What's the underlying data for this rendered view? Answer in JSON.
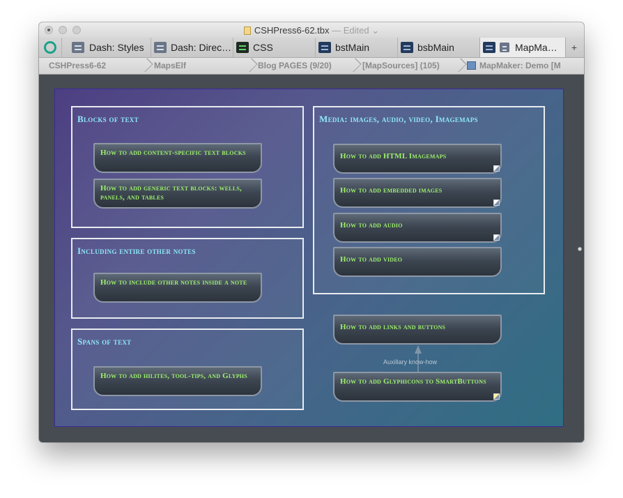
{
  "window": {
    "title": "CSHPress6-62.tbx",
    "edited": "— Edited"
  },
  "tabs": [
    {
      "label": "Dash: Styles"
    },
    {
      "label": "Dash: Direc…"
    },
    {
      "label": "CSS"
    },
    {
      "label": "bstMain"
    },
    {
      "label": "bsbMain"
    },
    {
      "label": "MapMa…"
    }
  ],
  "new_tab_label": "+",
  "breadcrumbs": [
    "CSHPress6-62",
    "MapsElf",
    "Blog PAGES (9/20)",
    "[MapSources] (105)",
    "MapMaker: Demo [M"
  ],
  "map": {
    "containers": [
      {
        "title": "Blocks of text",
        "notes": [
          "How to add content-specific text blocks",
          "How to add generic text blocks: wells, panels, and tables"
        ]
      },
      {
        "title": "Including entire other notes",
        "notes": [
          "How to include other notes inside a note"
        ]
      },
      {
        "title": "Spans of text",
        "notes": [
          "How to add hilites, tool-tips, and Glyphs"
        ]
      },
      {
        "title": "Media: images, audio, video, Imagemaps",
        "notes": [
          "How to add HTML Imagemaps",
          "How to add embedded images",
          "How to add audio",
          "How to add video"
        ]
      }
    ],
    "loose_notes": [
      "How to add links and buttons",
      "How to add Glyphicons to SmartButtons"
    ],
    "link_label": "Auxillary know-how"
  }
}
